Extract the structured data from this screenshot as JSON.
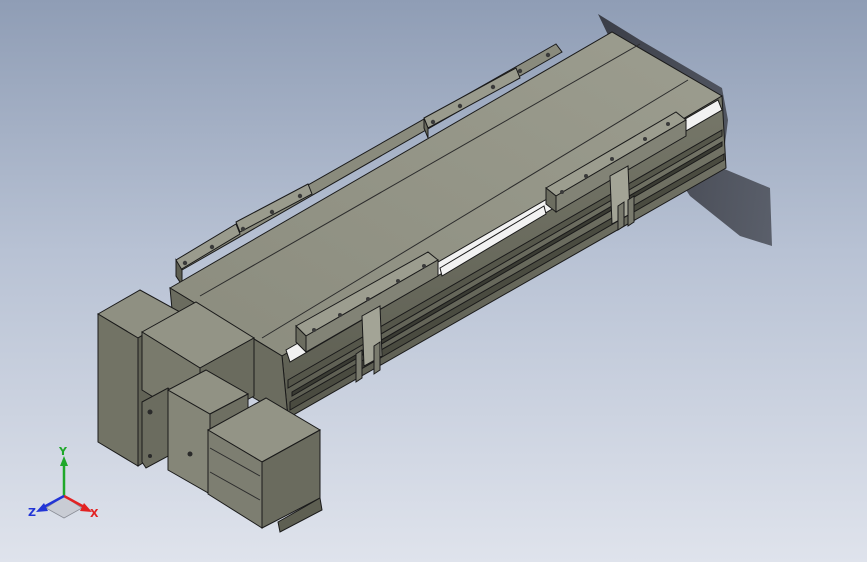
{
  "colors": {
    "background_top": "#8f9db5",
    "background_bottom": "#dfe3ec",
    "part_face_light": "#97988a",
    "part_face_mid": "#7f8072",
    "part_face_dark": "#626356",
    "edge": "#1a1a1a",
    "rail_highlight": "#f2f2f2",
    "axis_x": "#e22222",
    "axis_y": "#1fa82a",
    "axis_z": "#2235d6"
  },
  "triad": {
    "x_label": "X",
    "y_label": "Y",
    "z_label": "Z"
  }
}
